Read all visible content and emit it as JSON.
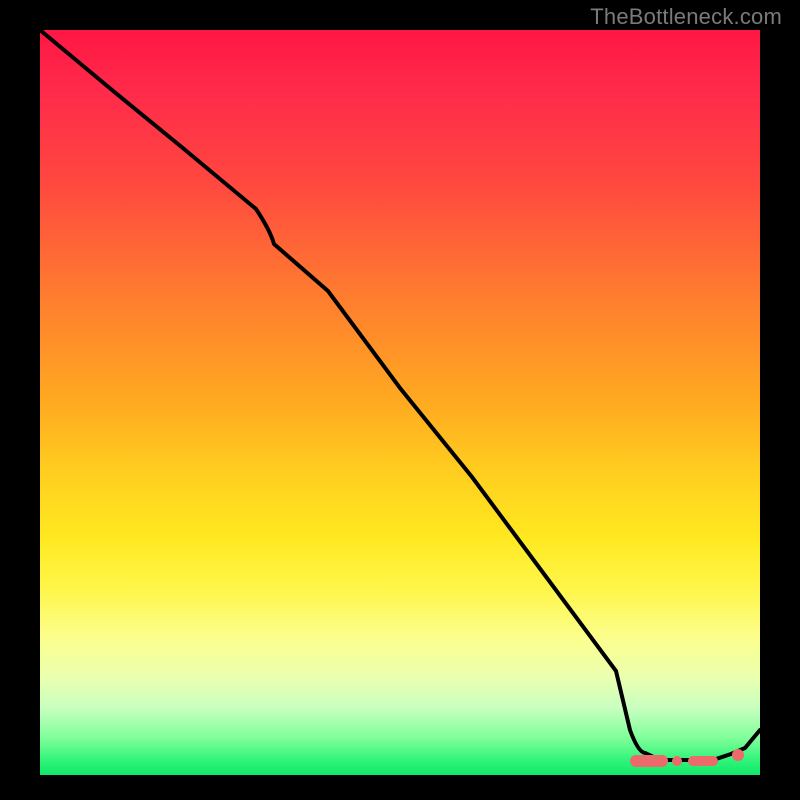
{
  "watermark": "TheBottleneck.com",
  "chart_data": {
    "type": "line",
    "title": "",
    "xlabel": "",
    "ylabel": "",
    "xlim": [
      0,
      100
    ],
    "ylim": [
      0,
      100
    ],
    "grid": false,
    "legend": false,
    "note": "No axis ticks or labels are visible; values below are estimated normalized positions (0–100) read from pixel geometry.",
    "series": [
      {
        "name": "curve",
        "color": "#000000",
        "x": [
          0,
          10,
          20,
          30,
          40,
          50,
          60,
          70,
          80,
          82,
          84,
          86,
          88,
          90,
          92,
          94,
          96,
          98,
          100
        ],
        "y": [
          100,
          92,
          84,
          76,
          65,
          52,
          40,
          27,
          14,
          6,
          3,
          2,
          2,
          2,
          2,
          2,
          2,
          3,
          6
        ]
      }
    ],
    "markers": [
      {
        "name": "trough-left-pill",
        "shape": "pill",
        "color": "#ec6a6a",
        "x_range": [
          82,
          87
        ],
        "y": 2
      },
      {
        "name": "trough-dot-1",
        "shape": "dot",
        "color": "#ec6a6a",
        "x": 88.5,
        "y": 2
      },
      {
        "name": "trough-bar",
        "shape": "pill",
        "color": "#ec6a6a",
        "x_range": [
          90,
          93
        ],
        "y": 2
      },
      {
        "name": "trough-dot-2",
        "shape": "dot",
        "color": "#ec6a6a",
        "x": 97,
        "y": 3
      }
    ]
  }
}
